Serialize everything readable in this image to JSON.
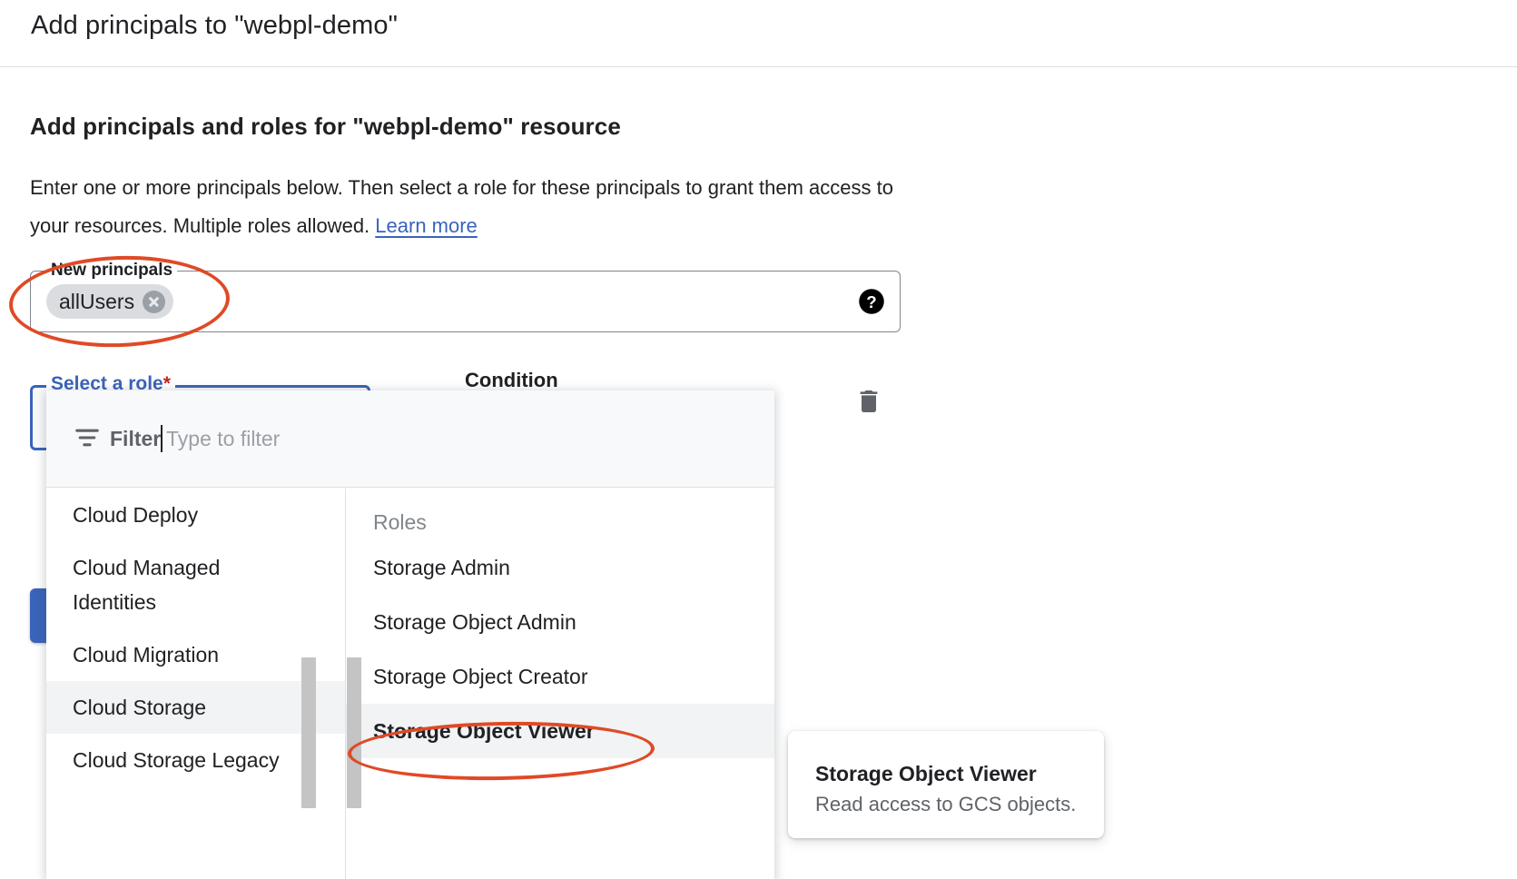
{
  "dialog": {
    "title": "Add principals to \"webpl-demo\""
  },
  "section": {
    "heading": "Add principals and roles for \"webpl-demo\" resource",
    "description_part1": "Enter one or more principals below. Then select a role for these principals to grant them access to your resources. Multiple roles allowed. ",
    "learn_more_label": "Learn more"
  },
  "principals_field": {
    "legend": "New principals",
    "chip_label": "allUsers",
    "remove_icon": "close-icon",
    "help_icon": "help-circle-icon"
  },
  "role_field": {
    "legend": "Select a role",
    "required_marker": "*",
    "value": ""
  },
  "condition_column": {
    "header": "Condition"
  },
  "actions": {
    "delete_icon": "trash-icon",
    "save_label": ""
  },
  "role_dropdown": {
    "filter": {
      "icon": "filter-icon",
      "label": "Filter",
      "value": "",
      "placeholder": "Type to filter"
    },
    "categories": [
      {
        "label": "Cloud Deploy",
        "selected": false
      },
      {
        "label": "Cloud Managed Identities",
        "selected": false
      },
      {
        "label": "Cloud Migration",
        "selected": false
      },
      {
        "label": "Cloud Storage",
        "selected": true
      },
      {
        "label": "Cloud Storage Legacy",
        "selected": false
      }
    ],
    "roles_caption": "Roles",
    "roles": [
      {
        "label": "Storage Admin",
        "selected": false
      },
      {
        "label": "Storage Object Admin",
        "selected": false
      },
      {
        "label": "Storage Object Creator",
        "selected": false
      },
      {
        "label": "Storage Object Viewer",
        "selected": true
      }
    ]
  },
  "role_tooltip": {
    "title": "Storage Object Viewer",
    "description": "Read access to GCS objects."
  },
  "annotations": {
    "color": "#df4a26",
    "items": [
      {
        "target": "new-principals-field"
      },
      {
        "target": "storage-object-viewer-role"
      }
    ]
  }
}
